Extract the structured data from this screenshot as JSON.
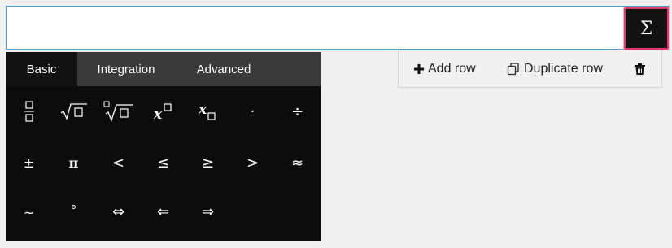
{
  "sigma_button": {
    "label": "Σ"
  },
  "keyboard": {
    "tabs": [
      {
        "label": "Basic",
        "active": true
      },
      {
        "label": "Integration",
        "active": false
      },
      {
        "label": "Advanced",
        "active": false
      }
    ],
    "keys": [
      [
        "fraction",
        "square-root",
        "nth-root",
        "superscript",
        "subscript",
        "·",
        "÷"
      ],
      [
        "±",
        "π",
        "<",
        "≤",
        "≥",
        ">",
        "≈"
      ],
      [
        "~",
        "°",
        "⇔",
        "⇐",
        "⇒"
      ]
    ]
  },
  "toolbar": {
    "add_row": "Add row",
    "duplicate_row": "Duplicate row"
  },
  "colors": {
    "keyboard_bg": "#0c0c0c",
    "tab_bar_bg": "#3a3a3a",
    "focus_border": "#e0396f",
    "input_border": "#4a9bd3"
  }
}
